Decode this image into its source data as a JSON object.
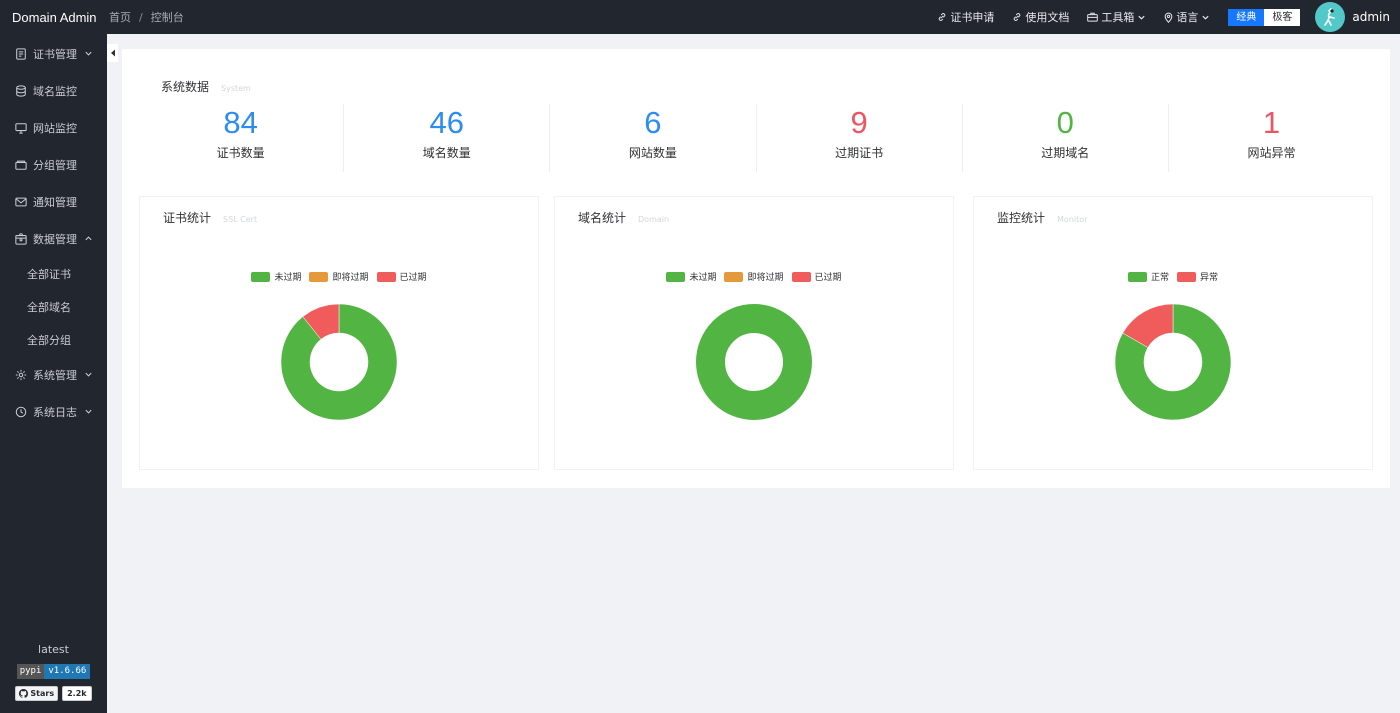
{
  "header": {
    "brand": "Domain Admin",
    "breadcrumb": [
      "首页",
      "控制台"
    ],
    "links": {
      "cert_apply": "证书申请",
      "docs": "使用文档",
      "toolbox": "工具箱",
      "language": "语言"
    },
    "theme": {
      "classic": "经典",
      "geek": "极客"
    },
    "username": "admin"
  },
  "sidebar": {
    "items": [
      {
        "label": "证书管理",
        "icon": "file-icon",
        "caret": "down"
      },
      {
        "label": "域名监控",
        "icon": "database-icon"
      },
      {
        "label": "网站监控",
        "icon": "monitor-icon"
      },
      {
        "label": "分组管理",
        "icon": "folder-icon"
      },
      {
        "label": "通知管理",
        "icon": "mail-icon"
      },
      {
        "label": "数据管理",
        "icon": "box-icon",
        "caret": "up"
      }
    ],
    "subitems": [
      "全部证书",
      "全部域名",
      "全部分组"
    ],
    "items_after": [
      {
        "label": "系统管理",
        "icon": "gear-icon",
        "caret": "down"
      },
      {
        "label": "系统日志",
        "icon": "clock-icon",
        "caret": "down"
      }
    ],
    "footer": {
      "version": "latest",
      "pypi_label": "pypi",
      "pypi_version": "v1.6.66",
      "stars_label": "Stars",
      "stars_count": "2.2k"
    }
  },
  "system": {
    "title": "系统数据",
    "subtitle": "System",
    "stats": [
      {
        "value": "84",
        "label": "证书数量",
        "color": "#2d8cf0"
      },
      {
        "value": "46",
        "label": "域名数量",
        "color": "#2d8cf0"
      },
      {
        "value": "6",
        "label": "网站数量",
        "color": "#2d8cf0"
      },
      {
        "value": "9",
        "label": "过期证书",
        "color": "#ed5565"
      },
      {
        "value": "0",
        "label": "过期域名",
        "color": "#52b543"
      },
      {
        "value": "1",
        "label": "网站异常",
        "color": "#ed5565"
      }
    ]
  },
  "colors": {
    "green": "#52b543",
    "orange": "#e6993a",
    "red": "#f05c5c"
  },
  "chart_data": [
    {
      "type": "pie",
      "title": "证书统计",
      "subtitle": "SSL Cert",
      "categories": [
        "未过期",
        "即将过期",
        "已过期"
      ],
      "values": [
        75,
        0,
        9
      ],
      "colors": [
        "#52b543",
        "#e6993a",
        "#f05c5c"
      ]
    },
    {
      "type": "pie",
      "title": "域名统计",
      "subtitle": "Domain",
      "categories": [
        "未过期",
        "即将过期",
        "已过期"
      ],
      "values": [
        46,
        0,
        0
      ],
      "colors": [
        "#52b543",
        "#e6993a",
        "#f05c5c"
      ]
    },
    {
      "type": "pie",
      "title": "监控统计",
      "subtitle": "Monitor",
      "categories": [
        "正常",
        "异常"
      ],
      "values": [
        5,
        1
      ],
      "colors": [
        "#52b543",
        "#f05c5c"
      ]
    }
  ]
}
